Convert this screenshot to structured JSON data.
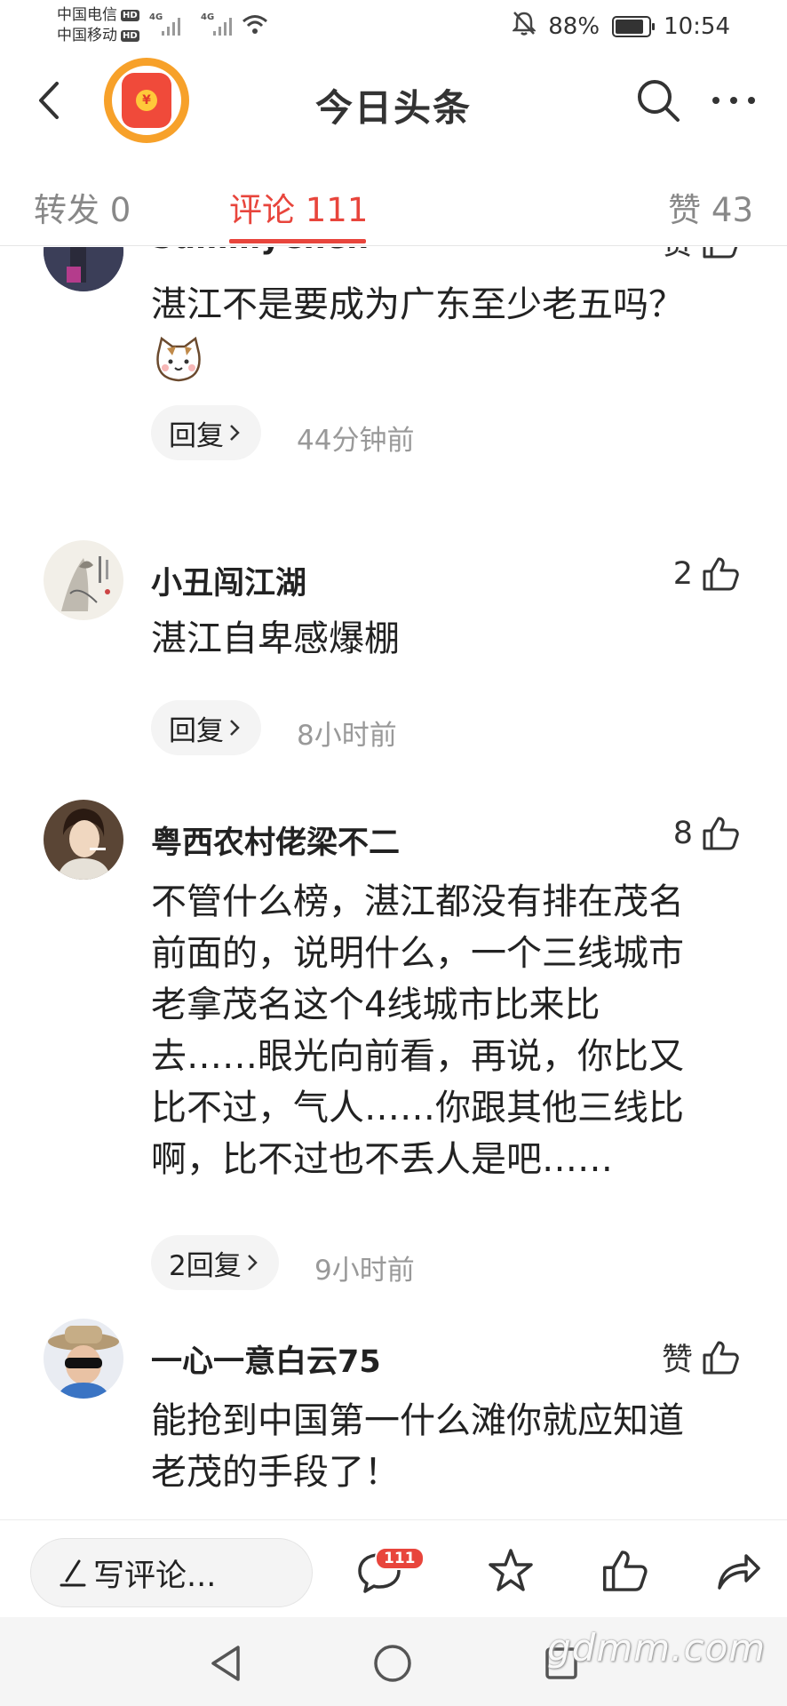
{
  "status_bar": {
    "carrier_1": "中国电信",
    "carrier_2": "中国移动",
    "hd_label": "HD",
    "network_label": "4G",
    "battery": "88%",
    "time": "10:54"
  },
  "header": {
    "title": "今日头条",
    "logo_symbol": "¥"
  },
  "tabs": {
    "forward": "转发 0",
    "comment": "评论 111",
    "like": "赞 43"
  },
  "comments": [
    {
      "user": "SummyChen",
      "likes": "赞",
      "text": "湛江不是要成为广东至少老五吗？",
      "reply": "回复",
      "time": "44分钟前"
    },
    {
      "user": "小丑闯江湖",
      "likes": "2",
      "text": "湛江自卑感爆棚",
      "reply": "回复",
      "time": "8小时前"
    },
    {
      "user": "粤西农村佬梁不二",
      "likes": "8",
      "text_lines": [
        "不管什么榜，湛江都没有排在茂名",
        "前面的，说明什么，一个三线城市",
        "老拿茂名这个4线城市比来比",
        "去……眼光向前看，再说，你比又",
        "比不过，气人……你跟其他三线比",
        "啊，比不过也不丢人是吧……"
      ],
      "reply": "2回复",
      "time": "9小时前"
    },
    {
      "user": "一心一意白云75",
      "likes": "赞",
      "text_lines": [
        "能抢到中国第一什么滩你就应知道",
        "老茂的手段了！"
      ]
    }
  ],
  "bottom_bar": {
    "write_placeholder": "写评论...",
    "comment_count": "111"
  },
  "watermark": "gdmm.com",
  "colors": {
    "accent": "#e8453c",
    "logo_ring": "#f7a12a",
    "logo_fill": "#f04a3a"
  }
}
